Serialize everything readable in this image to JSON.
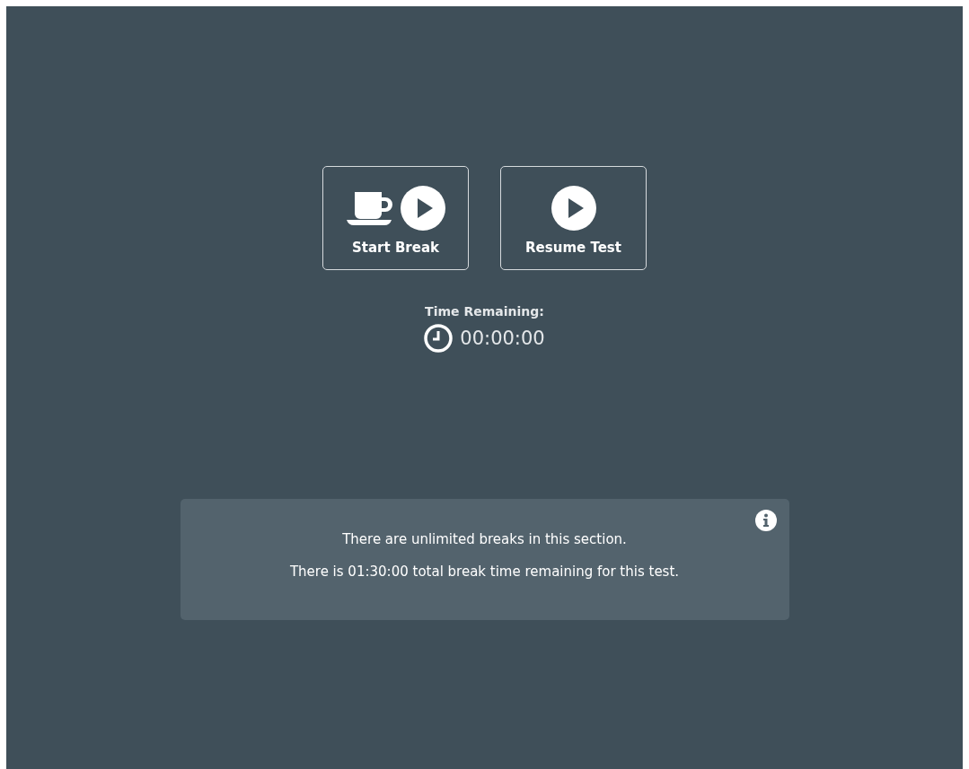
{
  "buttons": [
    {
      "label": "Start Break",
      "kind": "break"
    },
    {
      "label": "Resume Test",
      "kind": "resume"
    }
  ],
  "timer": {
    "label": "Time Remaining:",
    "value": "00:00:00"
  },
  "info": {
    "lines": [
      "There are unlimited breaks in this section.",
      "There is 01:30:00 total break time remaining for this test."
    ]
  }
}
